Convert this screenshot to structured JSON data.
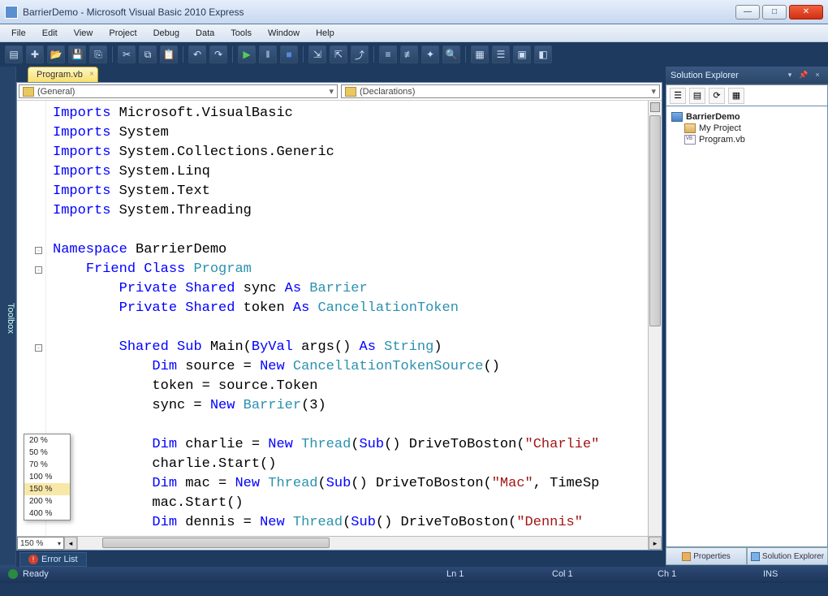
{
  "window": {
    "title": "BarrierDemo - Microsoft Visual Basic 2010 Express"
  },
  "menu": {
    "items": [
      "File",
      "Edit",
      "View",
      "Project",
      "Debug",
      "Data",
      "Tools",
      "Window",
      "Help"
    ]
  },
  "documentTab": {
    "label": "Program.vb"
  },
  "dropdowns": {
    "scope": "(General)",
    "member": "(Declarations)"
  },
  "code": {
    "lines": [
      {
        "t": "import",
        "ns": "Microsoft.VisualBasic"
      },
      {
        "t": "import",
        "ns": "System"
      },
      {
        "t": "import",
        "ns": "System.Collections.Generic"
      },
      {
        "t": "import",
        "ns": "System.Linq"
      },
      {
        "t": "import",
        "ns": "System.Text"
      },
      {
        "t": "import",
        "ns": "System.Threading"
      },
      {
        "t": "blank"
      },
      {
        "t": "ns_open",
        "name": "BarrierDemo"
      },
      {
        "t": "class_open",
        "mod": "Friend",
        "kw": "Class",
        "name": "Program"
      },
      {
        "t": "field",
        "mods": "Private Shared",
        "name": "sync",
        "as": "Barrier"
      },
      {
        "t": "field",
        "mods": "Private Shared",
        "name": "token",
        "as": "CancellationToken"
      },
      {
        "t": "blank"
      },
      {
        "t": "sub_open",
        "mods": "Shared",
        "kw": "Sub",
        "name": "Main",
        "sig": "ByVal args() As String"
      },
      {
        "t": "dim_new",
        "name": "source",
        "type": "CancellationTokenSource",
        "args": ""
      },
      {
        "t": "assign",
        "lhs": "token",
        "rhs_plain": "source.Token"
      },
      {
        "t": "assign_new",
        "lhs": "sync",
        "type": "Barrier",
        "args": "3"
      },
      {
        "t": "blank"
      },
      {
        "t": "dim_thread",
        "name": "charlie",
        "arg": "\"Charlie\"",
        "trail": ""
      },
      {
        "t": "call",
        "expr": "charlie.Start()"
      },
      {
        "t": "dim_thread",
        "name": "mac",
        "arg": "\"Mac\"",
        "trail": ", TimeSp"
      },
      {
        "t": "call",
        "expr": "mac.Start()"
      },
      {
        "t": "dim_thread_cut",
        "name": "dennis",
        "arg": "\"Dennis\""
      }
    ]
  },
  "zoom": {
    "current": "150 %",
    "options": [
      "20 %",
      "50 %",
      "70 %",
      "100 %",
      "150 %",
      "200 %",
      "400 %"
    ],
    "selectedIndex": 4
  },
  "solutionExplorer": {
    "title": "Solution Explorer",
    "project": "BarrierDemo",
    "items": [
      {
        "icon": "prop",
        "label": "My Project"
      },
      {
        "icon": "file",
        "label": "Program.vb"
      }
    ]
  },
  "bottomTabs": {
    "properties": "Properties",
    "solution": "Solution Explorer"
  },
  "errorList": {
    "label": "Error List"
  },
  "toolbox": {
    "label": "Toolbox"
  },
  "status": {
    "ready": "Ready",
    "ln": "Ln 1",
    "col": "Col 1",
    "ch": "Ch 1",
    "ins": "INS"
  }
}
